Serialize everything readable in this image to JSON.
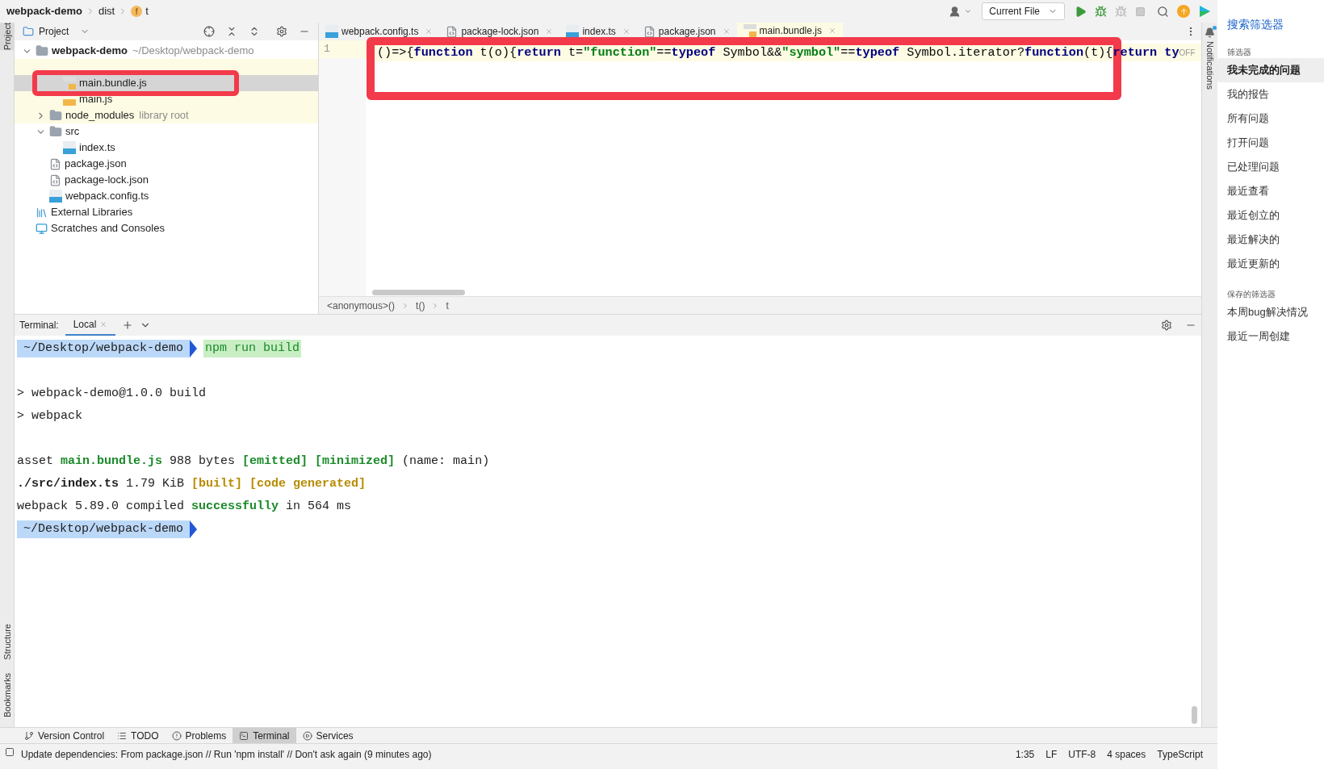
{
  "breadcrumb": [
    {
      "label": "webpack-demo",
      "kind": "project"
    },
    {
      "label": "dist",
      "kind": "folder"
    },
    {
      "label": "f",
      "kind": "badge"
    },
    {
      "label": "t",
      "kind": "plain"
    }
  ],
  "toolbar": {
    "run_config": "Current File"
  },
  "project_panel": {
    "title": "Project",
    "tree": [
      {
        "label": "webpack-demo",
        "hint": "~/Desktop/webpack-demo",
        "kind": "root",
        "expanded": true,
        "selected": false,
        "excluded": false,
        "children": [
          {
            "kind": "covered",
            "selected": false,
            "excluded": true,
            "children": [
              {
                "label": "main.bundle.js",
                "kind": "bundle",
                "selected": true,
                "highlighted": true
              },
              {
                "label": "main.js",
                "kind": "js",
                "selected": false,
                "excluded": true
              }
            ]
          },
          {
            "label": "node_modules",
            "hint": "library root",
            "kind": "folder",
            "expanded": false,
            "selected": false,
            "excluded": true
          },
          {
            "label": "src",
            "kind": "folder",
            "expanded": true,
            "selected": false,
            "excluded": false,
            "children": [
              {
                "label": "index.ts",
                "kind": "ts",
                "selected": false,
                "excluded": false
              }
            ]
          },
          {
            "label": "package.json",
            "kind": "json",
            "selected": false,
            "excluded": false
          },
          {
            "label": "package-lock.json",
            "kind": "json",
            "selected": false,
            "excluded": false
          },
          {
            "label": "webpack.config.ts",
            "kind": "ts",
            "selected": false,
            "excluded": false
          }
        ]
      },
      {
        "label": "External Libraries",
        "kind": "libraries",
        "selected": false,
        "excluded": false
      },
      {
        "label": "Scratches and Consoles",
        "kind": "scratches",
        "selected": false,
        "excluded": false
      }
    ]
  },
  "editor_tabs": [
    {
      "label": "webpack.config.ts",
      "kind": "ts",
      "selected": false
    },
    {
      "label": "package-lock.json",
      "kind": "json",
      "selected": false
    },
    {
      "label": "index.ts",
      "kind": "ts",
      "selected": false
    },
    {
      "label": "package.json",
      "kind": "json",
      "selected": false
    },
    {
      "label": "main.bundle.js",
      "kind": "bundle",
      "selected": true
    }
  ],
  "editor": {
    "line_numbers": [
      "1"
    ],
    "highlighted": true,
    "code": [
      {
        "text": "()=>{",
        "kind": "plain"
      },
      {
        "text": "function",
        "kind": "keyword"
      },
      {
        "text": " t(o){",
        "kind": "plain"
      },
      {
        "text": "return",
        "kind": "keyword"
      },
      {
        "text": " t=",
        "kind": "plain"
      },
      {
        "text": "\"function\"",
        "kind": "string"
      },
      {
        "text": "==",
        "kind": "plain"
      },
      {
        "text": "typeof",
        "kind": "keyword"
      },
      {
        "text": " Symbol&&",
        "kind": "plain"
      },
      {
        "text": "\"symbol\"",
        "kind": "string"
      },
      {
        "text": "==",
        "kind": "plain"
      },
      {
        "text": "typeof",
        "kind": "keyword"
      },
      {
        "text": " Symbol.iterator?",
        "kind": "plain"
      },
      {
        "text": "function",
        "kind": "keyword"
      },
      {
        "text": "(t){",
        "kind": "plain"
      },
      {
        "text": "return",
        "kind": "keyword"
      },
      {
        "text": " ty",
        "kind": "keyword"
      }
    ],
    "reader_mode": "OFF",
    "breadcrumbs": [
      "<anonymous>()",
      "t()",
      "t"
    ]
  },
  "terminal": {
    "title": "Terminal:",
    "tabs": [
      {
        "label": "Local",
        "selected": true
      }
    ],
    "lines": [
      {
        "kind": "prompt",
        "path": "~/Desktop/webpack-demo",
        "command": "npm run build"
      },
      {
        "kind": "blank"
      },
      {
        "kind": "output",
        "segments": [
          {
            "text": "> webpack-demo@1.0.0 build",
            "kind": "plain"
          }
        ]
      },
      {
        "kind": "output",
        "segments": [
          {
            "text": "> webpack",
            "kind": "plain"
          }
        ]
      },
      {
        "kind": "blank"
      },
      {
        "kind": "output",
        "segments": [
          {
            "text": "asset ",
            "kind": "plain"
          },
          {
            "text": "main.bundle.js",
            "kind": "success"
          },
          {
            "text": " 988 bytes ",
            "kind": "plain"
          },
          {
            "text": "[emitted] [minimized]",
            "kind": "success"
          },
          {
            "text": " (name: main)",
            "kind": "plain"
          }
        ]
      },
      {
        "kind": "output",
        "segments": [
          {
            "text": "./src/index.ts",
            "kind": "path"
          },
          {
            "text": " 1.79 KiB ",
            "kind": "plain"
          },
          {
            "text": "[built] [code generated]",
            "kind": "warning"
          }
        ]
      },
      {
        "kind": "output",
        "segments": [
          {
            "text": "webpack 5.89.0 compiled ",
            "kind": "plain"
          },
          {
            "text": "successfully",
            "kind": "success"
          },
          {
            "text": " in 564 ms",
            "kind": "plain"
          }
        ]
      },
      {
        "kind": "prompt",
        "path": "~/Desktop/webpack-demo"
      }
    ]
  },
  "side_strip": {
    "top": [
      {
        "label": "Project",
        "selected": true
      }
    ],
    "bottom": [
      {
        "label": "Structure",
        "selected": false
      },
      {
        "label": "Bookmarks",
        "selected": false
      }
    ],
    "right": "Notifications"
  },
  "tool_tabs": [
    {
      "label": "Version Control",
      "kind": "vcs",
      "selected": false
    },
    {
      "label": "TODO",
      "kind": "todo",
      "selected": false
    },
    {
      "label": "Problems",
      "kind": "problems",
      "selected": false
    },
    {
      "label": "Terminal",
      "kind": "terminal",
      "selected": true
    },
    {
      "label": "Services",
      "kind": "services",
      "selected": false
    }
  ],
  "status_bar": {
    "message": "Update dependencies: From package.json // Run 'npm install' // Don't ask again (9 minutes ago)",
    "items": [
      "1:35",
      "LF",
      "UTF-8",
      "4 spaces",
      "TypeScript"
    ]
  },
  "filter_panel": {
    "search": "搜索筛选器",
    "sections": [
      {
        "title": "筛选器",
        "items": [
          {
            "label": "我未完成的问题",
            "selected": true
          },
          {
            "label": "我的报告",
            "selected": false
          },
          {
            "label": "所有问题",
            "selected": false
          },
          {
            "label": "打开问题",
            "selected": false
          },
          {
            "label": "已处理问题",
            "selected": false
          },
          {
            "label": "最近查看",
            "selected": false
          },
          {
            "label": "最近创立的",
            "selected": false
          },
          {
            "label": "最近解决的",
            "selected": false
          },
          {
            "label": "最近更新的",
            "selected": false
          }
        ]
      },
      {
        "title": "保存的筛选器",
        "items": [
          {
            "label": "本周bug解决情况",
            "selected": false
          },
          {
            "label": "最近一周创建",
            "selected": false
          }
        ]
      }
    ]
  }
}
